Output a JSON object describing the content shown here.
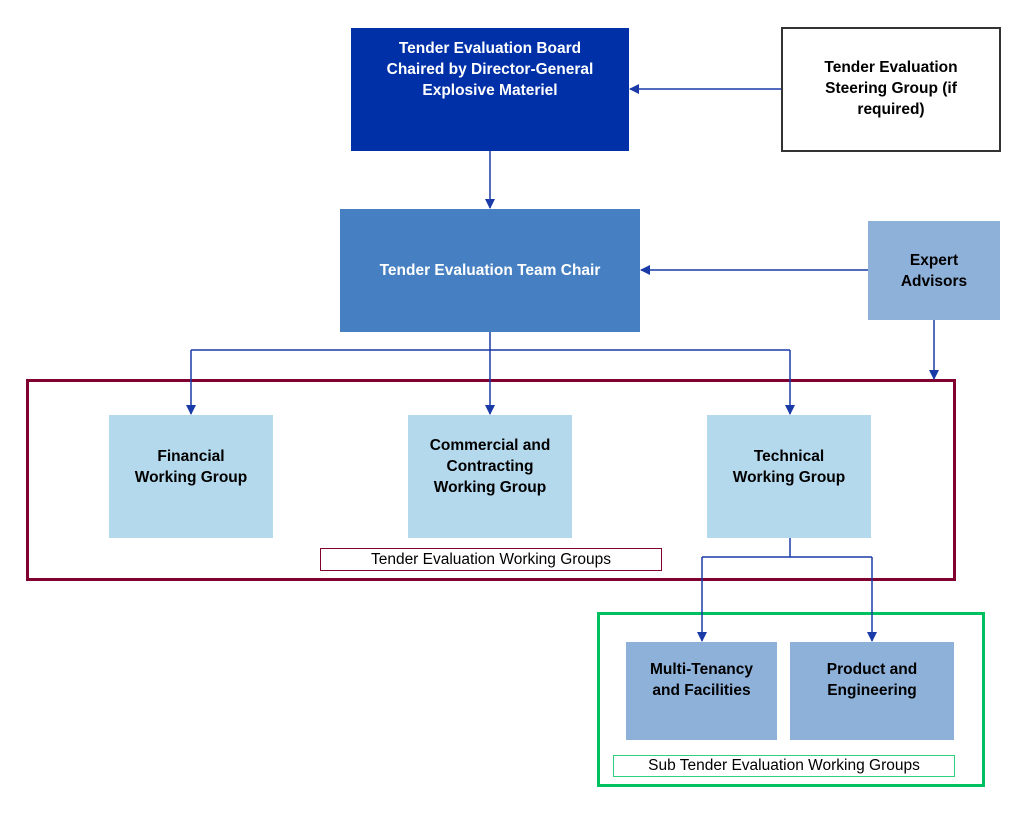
{
  "nodes": {
    "board": "Tender Evaluation Board\nChaired by Director-General\nExplosive Materiel",
    "steering": "Tender Evaluation\nSteering Group (if\nrequired)",
    "team_chair": "Tender Evaluation Team Chair",
    "expert": "Expert\nAdvisors",
    "financial": "Financial\nWorking Group",
    "commercial": "Commercial and\nContracting\nWorking Group",
    "technical": "Technical\nWorking Group",
    "multi_tenancy": "Multi-Tenancy\nand Facilities",
    "product": "Product and\nEngineering"
  },
  "groups": {
    "working_groups": "Tender Evaluation Working Groups",
    "sub_working_groups": "Sub Tender Evaluation Working Groups"
  },
  "colors": {
    "board": "#0030a8",
    "team_chair": "#4680c2",
    "expert": "#8eb1da",
    "working_group": "#b4d8ec",
    "sub_group": "#8eb1da",
    "connector": "#1a3aa8",
    "working_groups_frame": "#800030",
    "sub_groups_frame": "#00c060"
  }
}
